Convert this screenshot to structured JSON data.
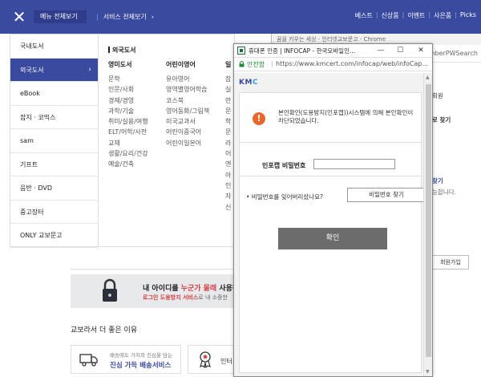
{
  "topbar": {
    "menu_all": "메뉴 전체보기",
    "service_all": "서비스 전체보기",
    "right_links": [
      "베스트",
      "신상품",
      "이벤트",
      "사은품",
      "Picks"
    ]
  },
  "left_nav": {
    "items": [
      {
        "label": "국내도서"
      },
      {
        "label": "외국도서"
      },
      {
        "label": "eBook"
      },
      {
        "label": "잡지 · 코믹스"
      },
      {
        "label": "sam"
      },
      {
        "label": "기프트"
      },
      {
        "label": "음반 · DVD"
      },
      {
        "label": "중고장터"
      },
      {
        "label": "ONLY 교보문고"
      }
    ]
  },
  "mega": {
    "title": "외국도서",
    "col1": {
      "heading": "영미도서",
      "items": [
        "문학",
        "인문/사회",
        "경제/경영",
        "과학/기술",
        "취미/실용/여행",
        "ELT/어학/사전",
        "교재",
        "생활/요리/건강",
        "예술/건축"
      ]
    },
    "col2": {
      "heading": "어린이영어",
      "items": [
        "유아영어",
        "영역별영어학습",
        "코스북",
        "영어동화/그림책",
        "미국교과서",
        "어린이중국어",
        "어린이일본어"
      ]
    },
    "col3": {
      "heading": "일",
      "items": [
        "잡",
        "실",
        "만",
        "문",
        "학",
        "문",
        "라",
        "어",
        "엔",
        "아",
        "인",
        "자",
        "신"
      ]
    }
  },
  "background": {
    "banner_line1_pre": "내 아이디를 ",
    "banner_line1_hl": "누군가 몰래",
    "banner_line1_post": " 사용하",
    "banner_line2_hl": "로그인 도용방지 서비스",
    "banner_line2_post": "로 내 소중한",
    "reason_title": "교보라서 더 좋은 이유",
    "card1_line1": "배송에도 가치와 진심을 담는",
    "card1_line2": "진심 가득 배송서비스",
    "card2_label": "인터"
  },
  "back_window": {
    "title": "꿈을 키우는 세상 - 인터넷교보문고 - Chrome",
    "address_tail": "emberPWSearch",
    "texts": [
      "회원",
      "로 찾기",
      "찾기",
      "능합니다."
    ],
    "join_label": "회원가입"
  },
  "popup": {
    "window_title": "휴대폰 인증 | INFOCAP - 한국모바일인...",
    "secure_label": "안전함",
    "url": "https://www.kmcert.com/infocap/web/infoCap...",
    "brand_k": "K",
    "brand_m": "M",
    "brand_c": "C",
    "alert_icon": "!",
    "alert_message": "본인확인(도용방지(인포캡))시스템에 의해 본인확인이 차단되었습니다.",
    "pw_label": "인포캡 비밀번호",
    "pw_value": "",
    "forgot_question": "• 비밀번호를 잊어버리셨나요?",
    "find_pw_button": "비밀번호 찾기",
    "confirm_button": "확인"
  },
  "colors": {
    "topbar": "#3a4a9e",
    "alert": "#e8672c",
    "secure": "#1f8a3a",
    "confirm": "#6c6c6c"
  }
}
